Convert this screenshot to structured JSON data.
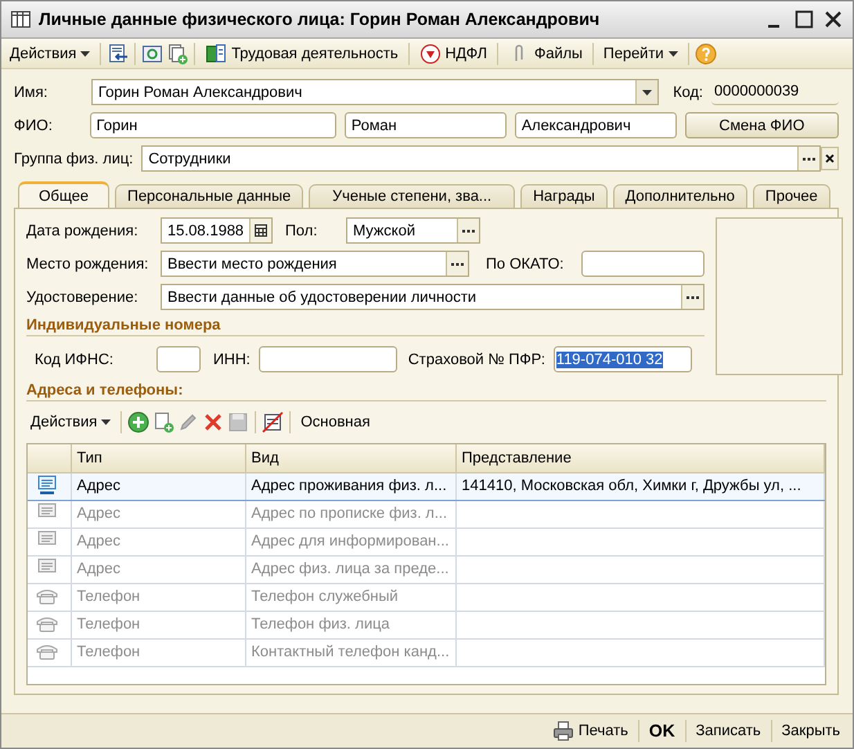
{
  "window": {
    "title": "Личные данные физического лица: Горин Роман Александрович"
  },
  "toolbar": {
    "actions": "Действия",
    "labor": "Трудовая деятельность",
    "ndfl": "НДФЛ",
    "files": "Файлы",
    "goto": "Перейти"
  },
  "header": {
    "name_label": "Имя:",
    "name": "Горин Роман Александрович",
    "code_label": "Код:",
    "code": "0000000039",
    "fio_label": "ФИО:",
    "last": "Горин",
    "first": "Роман",
    "middle": "Александрович",
    "change_button": "Смена ФИО",
    "group_label": "Группа физ. лиц:",
    "group": "Сотрудники"
  },
  "tabs": [
    {
      "label": "Общее",
      "selected": true
    },
    {
      "label": "Персональные данные",
      "selected": false
    },
    {
      "label": "Ученые степени, зва...",
      "selected": false
    },
    {
      "label": "Награды",
      "selected": false
    },
    {
      "label": "Дополнительно",
      "selected": false
    },
    {
      "label": "Прочее",
      "selected": false
    }
  ],
  "general": {
    "birth_label": "Дата рождения:",
    "birth": "15.08.1988",
    "sex_label": "Пол:",
    "sex": "Мужской",
    "place_label": "Место рождения:",
    "place": "Ввести место рождения",
    "okato_label": "По ОКАТО:",
    "id_label": "Удостоверение:",
    "id": "Ввести данные об удостоверении личности",
    "numbers_title": "Индивидуальные номера",
    "ifns_label": "Код ИФНС:",
    "inn_label": "ИНН:",
    "pfr_label": "Страховой № ПФР:",
    "pfr": "119-074-010 32",
    "contacts_title": "Адреса и телефоны:"
  },
  "contacts_toolbar": {
    "actions": "Действия",
    "main": "Основная"
  },
  "table": {
    "columns": [
      "Тип",
      "Вид",
      "Представление"
    ],
    "rows": [
      {
        "kind": "address",
        "filled": true,
        "selected": true,
        "type": "Адрес",
        "view": "Адрес проживания физ. л...",
        "value": "141410, Московская обл, Химки г, Дружбы ул, ..."
      },
      {
        "kind": "address",
        "filled": false,
        "selected": false,
        "type": "Адрес",
        "view": "Адрес по прописке физ. л..."
      },
      {
        "kind": "address",
        "filled": false,
        "selected": false,
        "type": "Адрес",
        "view": "Адрес для информирован..."
      },
      {
        "kind": "address",
        "filled": false,
        "selected": false,
        "type": "Адрес",
        "view": "Адрес физ. лица за преде..."
      },
      {
        "kind": "phone",
        "filled": false,
        "selected": false,
        "type": "Телефон",
        "view": "Телефон служебный"
      },
      {
        "kind": "phone",
        "filled": false,
        "selected": false,
        "type": "Телефон",
        "view": "Телефон физ. лица"
      },
      {
        "kind": "phone",
        "filled": false,
        "selected": false,
        "type": "Телефон",
        "view": "Контактный телефон канд..."
      }
    ]
  },
  "footer": {
    "print": "Печать",
    "ok": "OK",
    "save": "Записать",
    "close": "Закрыть"
  }
}
